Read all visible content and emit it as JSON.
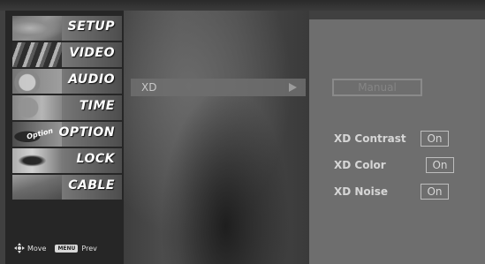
{
  "menu": {
    "items": [
      {
        "label": "SETUP",
        "icon": "setup-thumbnail"
      },
      {
        "label": "VIDEO",
        "icon": "video-thumbnail"
      },
      {
        "label": "AUDIO",
        "icon": "audio-thumbnail"
      },
      {
        "label": "TIME",
        "icon": "time-thumbnail"
      },
      {
        "label": "OPTION",
        "icon": "option-thumbnail",
        "tag": "Option"
      },
      {
        "label": "LOCK",
        "icon": "lock-thumbnail"
      },
      {
        "label": "CABLE",
        "icon": "cable-thumbnail"
      }
    ],
    "footer": {
      "move_label": "Move",
      "prev_key": "MENU",
      "prev_label": "Prev"
    }
  },
  "submenu": {
    "selected_item": "XD",
    "arrow_icon": "right-arrow-icon"
  },
  "xd_panel": {
    "mode_button": "Manual",
    "settings": [
      {
        "label": "XD Contrast",
        "value": "On"
      },
      {
        "label": "XD Color",
        "value": "On"
      },
      {
        "label": "XD Noise",
        "value": "On"
      }
    ]
  },
  "colors": {
    "background": "#404040",
    "sidebar": "#262626",
    "panel": "#6e6e6e",
    "highlight": "#6e6e6e",
    "text": "#ffffff"
  }
}
